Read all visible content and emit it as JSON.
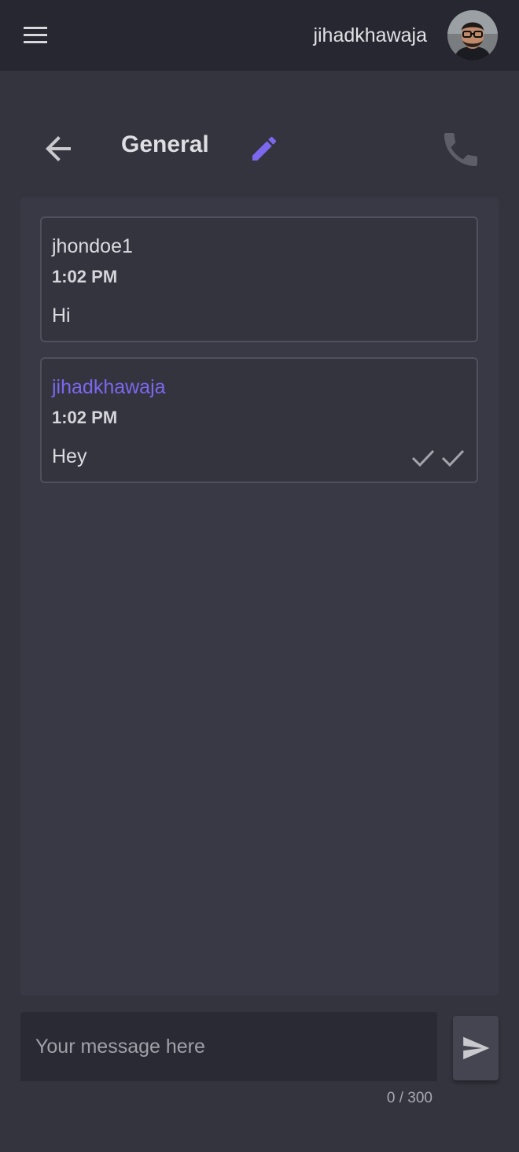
{
  "app_bar": {
    "menu_icon": "menu-icon",
    "username": "jihadkhawaja",
    "avatar_icon": "avatar"
  },
  "chat_header": {
    "back_icon": "arrow-back-icon",
    "title": "General",
    "edit_icon": "pencil-icon",
    "call_icon": "phone-icon"
  },
  "messages": [
    {
      "author": "jhondoe1",
      "time": "1:02 PM",
      "text": "Hi",
      "own": false
    },
    {
      "author": "jihadkhawaja",
      "time": "1:02 PM",
      "text": "Hey",
      "own": true,
      "status_icon": "double-check-icon"
    }
  ],
  "composer": {
    "value": "",
    "placeholder": "Your message here",
    "counter": "0 / 300",
    "send_icon": "send-icon"
  },
  "colors": {
    "accent": "#7b68ee",
    "background": "#33343e",
    "appbar": "#262730",
    "panel": "#383944"
  }
}
